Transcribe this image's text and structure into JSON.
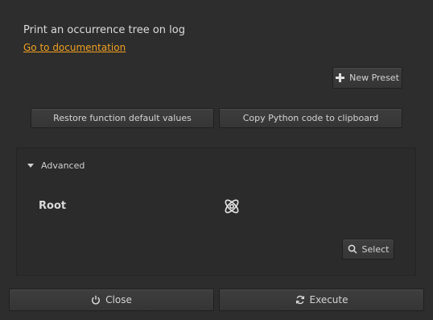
{
  "description": "Print an occurrence tree on log",
  "doc_link": "Go to documentation",
  "buttons": {
    "new_preset": "New Preset",
    "restore": "Restore function default values",
    "copy": "Copy Python code to clipboard",
    "select": "Select",
    "close": "Close",
    "execute": "Execute"
  },
  "advanced": {
    "label": "Advanced",
    "root_label": "Root"
  },
  "icons": {
    "new_preset": "plus-icon",
    "select": "search-icon",
    "close": "power-icon",
    "execute": "refresh-icon",
    "root": "assembly-icon",
    "advanced": "triangle-down-icon"
  },
  "colors": {
    "background": "#2d2d2d",
    "link": "#f0a020"
  }
}
